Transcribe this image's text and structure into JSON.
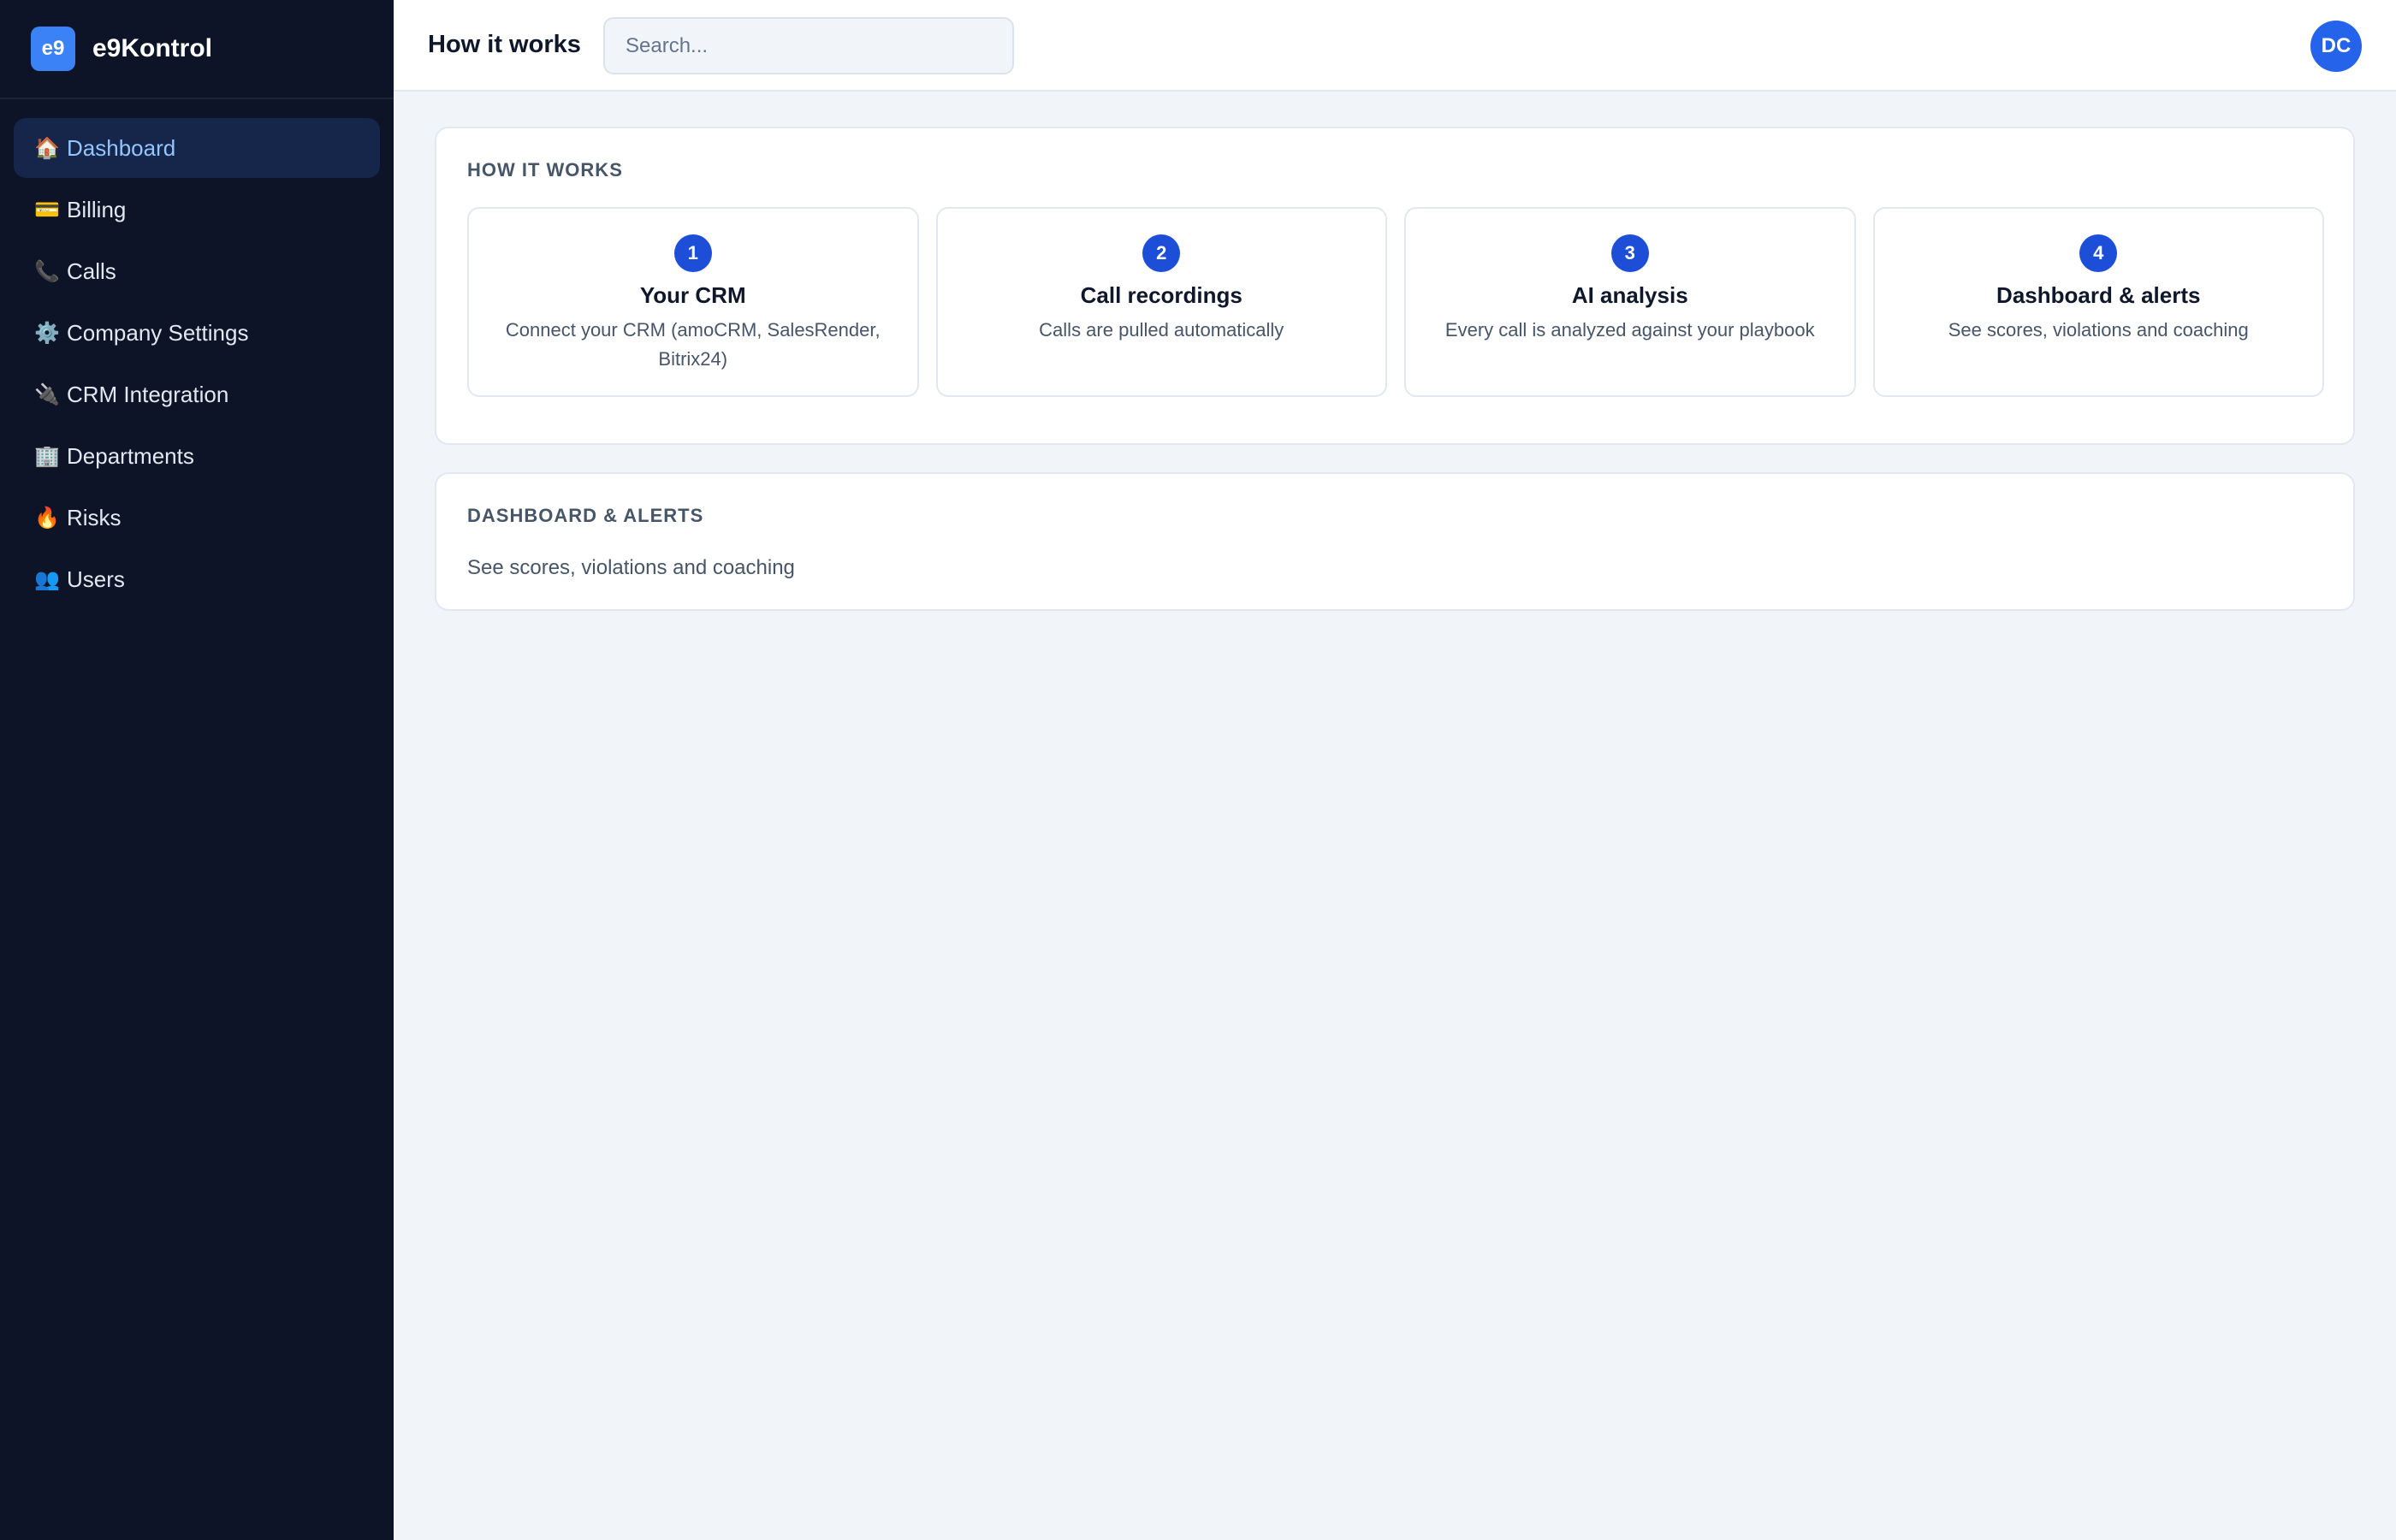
{
  "sidebar": {
    "logo_text": "e9",
    "brand_name": "e9Kontrol",
    "items": [
      {
        "icon": "🏠",
        "icon_name": "home-icon",
        "label": "Dashboard"
      },
      {
        "icon": "💳",
        "icon_name": "credit-card-icon",
        "label": "Billing"
      },
      {
        "icon": "📞",
        "icon_name": "phone-icon",
        "label": "Calls"
      },
      {
        "icon": "⚙️",
        "icon_name": "gear-icon",
        "label": "Company Settings"
      },
      {
        "icon": "🔌",
        "icon_name": "plug-icon",
        "label": "CRM Integration"
      },
      {
        "icon": "🏢",
        "icon_name": "building-icon",
        "label": "Departments"
      },
      {
        "icon": "🔥",
        "icon_name": "fire-icon",
        "label": "Risks"
      },
      {
        "icon": "👥",
        "icon_name": "users-icon",
        "label": "Users"
      }
    ],
    "active_index": 0
  },
  "header": {
    "title": "How it works",
    "search_placeholder": "Search...",
    "avatar_initials": "DC"
  },
  "how_it_works": {
    "heading": "HOW IT WORKS",
    "steps": [
      {
        "number": "1",
        "title": "Your CRM",
        "description": "Connect your CRM (amoCRM, SalesRender, Bitrix24)"
      },
      {
        "number": "2",
        "title": "Call recordings",
        "description": "Calls are pulled automatically"
      },
      {
        "number": "3",
        "title": "AI analysis",
        "description": "Every call is analyzed against your playbook"
      },
      {
        "number": "4",
        "title": "Dashboard & alerts",
        "description": "See scores, violations and coaching"
      }
    ]
  },
  "dashboard_alerts": {
    "heading": "DASHBOARD & ALERTS",
    "text": "See scores, violations and coaching"
  },
  "colors": {
    "sidebar_bg": "#0d1427",
    "accent": "#2563eb",
    "active_nav_bg": "#16254a",
    "active_nav_text": "#93c5fd",
    "page_bg": "#f1f5f9"
  }
}
